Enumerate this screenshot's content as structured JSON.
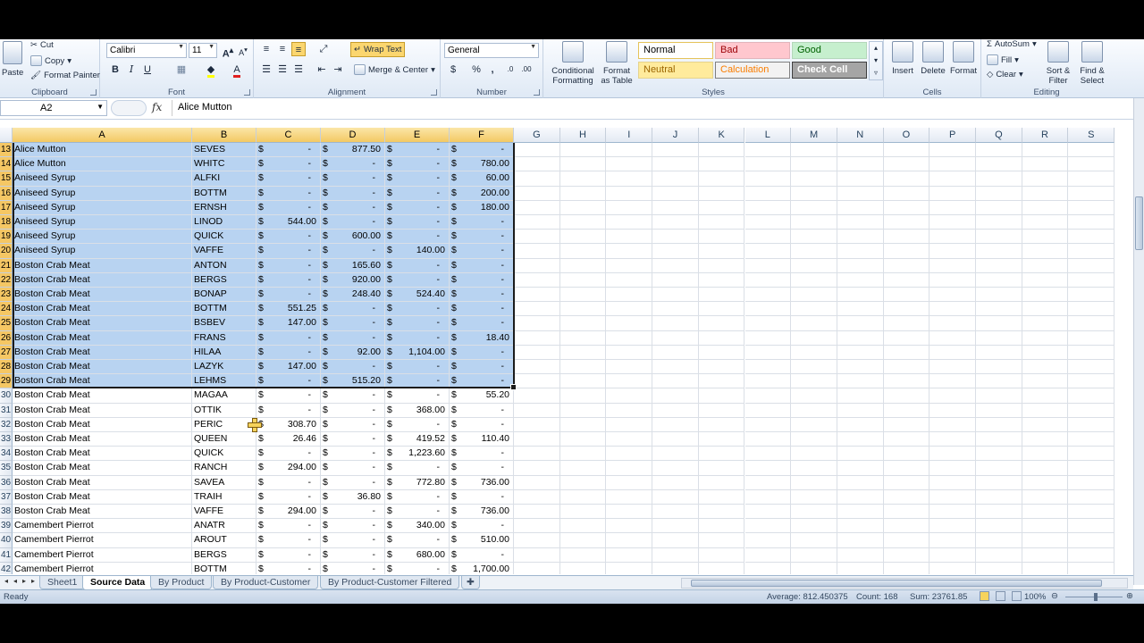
{
  "ribbon": {
    "clipboard": {
      "label": "Clipboard",
      "paste": "Paste",
      "cut": "Cut",
      "copy": "Copy",
      "format_painter": "Format Painter"
    },
    "font": {
      "label": "Font",
      "name": "Calibri",
      "size": "11",
      "bold": "B",
      "italic": "I",
      "underline": "U"
    },
    "alignment": {
      "label": "Alignment",
      "wrap_text": "Wrap Text",
      "merge_center": "Merge & Center"
    },
    "number": {
      "label": "Number",
      "format": "General",
      "currency": "$",
      "percent": "%",
      "comma": ","
    },
    "styles": {
      "label": "Styles",
      "conditional": "Conditional Formatting",
      "format_table": "Format as Table",
      "cells": [
        {
          "text": "Normal",
          "bg": "#ffffff",
          "fg": "#000000",
          "border": "#e5c35a"
        },
        {
          "text": "Bad",
          "bg": "#ffc7ce",
          "fg": "#9c0006",
          "border": "#e2b4ba"
        },
        {
          "text": "Good",
          "bg": "#c6efce",
          "fg": "#006100",
          "border": "#b3d7b9"
        },
        {
          "text": "Neutral",
          "bg": "#ffeb9c",
          "fg": "#9c6500",
          "border": "#e5d38c"
        },
        {
          "text": "Calculation",
          "bg": "#f2f2f2",
          "fg": "#fa7d00",
          "border": "#7f7f7f"
        },
        {
          "text": "Check Cell",
          "bg": "#a5a5a5",
          "fg": "#ffffff",
          "border": "#3f3f3f"
        }
      ]
    },
    "cells": {
      "label": "Cells",
      "insert": "Insert",
      "delete": "Delete",
      "format": "Format"
    },
    "editing": {
      "label": "Editing",
      "autosum": "AutoSum",
      "fill": "Fill",
      "clear": "Clear",
      "sort_filter": "Sort & Filter",
      "find_select": "Find & Select"
    }
  },
  "formula_bar": {
    "name_box": "A2",
    "fx": "fx",
    "content": "Alice Mutton"
  },
  "columns": [
    "A",
    "B",
    "C",
    "D",
    "E",
    "F",
    "G",
    "H",
    "I",
    "J",
    "K",
    "L",
    "M",
    "N",
    "O",
    "P",
    "Q",
    "R",
    "S"
  ],
  "selected_columns": [
    "A",
    "B",
    "C",
    "D",
    "E",
    "F"
  ],
  "rows": [
    {
      "n": "13",
      "a": "Alice Mutton",
      "b": "SEVES",
      "c": "-",
      "d": "877.50",
      "e": "-",
      "f": "-",
      "sel": true
    },
    {
      "n": "14",
      "a": "Alice Mutton",
      "b": "WHITC",
      "c": "-",
      "d": "-",
      "e": "-",
      "f": "780.00",
      "sel": true
    },
    {
      "n": "15",
      "a": "Aniseed Syrup",
      "b": "ALFKI",
      "c": "-",
      "d": "-",
      "e": "-",
      "f": "60.00",
      "sel": true
    },
    {
      "n": "16",
      "a": "Aniseed Syrup",
      "b": "BOTTM",
      "c": "-",
      "d": "-",
      "e": "-",
      "f": "200.00",
      "sel": true
    },
    {
      "n": "17",
      "a": "Aniseed Syrup",
      "b": "ERNSH",
      "c": "-",
      "d": "-",
      "e": "-",
      "f": "180.00",
      "sel": true
    },
    {
      "n": "18",
      "a": "Aniseed Syrup",
      "b": "LINOD",
      "c": "544.00",
      "d": "-",
      "e": "-",
      "f": "-",
      "sel": true
    },
    {
      "n": "19",
      "a": "Aniseed Syrup",
      "b": "QUICK",
      "c": "-",
      "d": "600.00",
      "e": "-",
      "f": "-",
      "sel": true
    },
    {
      "n": "20",
      "a": "Aniseed Syrup",
      "b": "VAFFE",
      "c": "-",
      "d": "-",
      "e": "140.00",
      "f": "-",
      "sel": true
    },
    {
      "n": "21",
      "a": "Boston Crab Meat",
      "b": "ANTON",
      "c": "-",
      "d": "165.60",
      "e": "-",
      "f": "-",
      "sel": true
    },
    {
      "n": "22",
      "a": "Boston Crab Meat",
      "b": "BERGS",
      "c": "-",
      "d": "920.00",
      "e": "-",
      "f": "-",
      "sel": true
    },
    {
      "n": "23",
      "a": "Boston Crab Meat",
      "b": "BONAP",
      "c": "-",
      "d": "248.40",
      "e": "524.40",
      "f": "-",
      "sel": true
    },
    {
      "n": "24",
      "a": "Boston Crab Meat",
      "b": "BOTTM",
      "c": "551.25",
      "d": "-",
      "e": "-",
      "f": "-",
      "sel": true
    },
    {
      "n": "25",
      "a": "Boston Crab Meat",
      "b": "BSBEV",
      "c": "147.00",
      "d": "-",
      "e": "-",
      "f": "-",
      "sel": true
    },
    {
      "n": "26",
      "a": "Boston Crab Meat",
      "b": "FRANS",
      "c": "-",
      "d": "-",
      "e": "-",
      "f": "18.40",
      "sel": true
    },
    {
      "n": "27",
      "a": "Boston Crab Meat",
      "b": "HILAA",
      "c": "-",
      "d": "92.00",
      "e": "1,104.00",
      "f": "-",
      "sel": true
    },
    {
      "n": "28",
      "a": "Boston Crab Meat",
      "b": "LAZYK",
      "c": "147.00",
      "d": "-",
      "e": "-",
      "f": "-",
      "sel": true
    },
    {
      "n": "29",
      "a": "Boston Crab Meat",
      "b": "LEHMS",
      "c": "-",
      "d": "515.20",
      "e": "-",
      "f": "-",
      "sel": true
    },
    {
      "n": "30",
      "a": "Boston Crab Meat",
      "b": "MAGAA",
      "c": "-",
      "d": "-",
      "e": "-",
      "f": "55.20",
      "sel": false
    },
    {
      "n": "31",
      "a": "Boston Crab Meat",
      "b": "OTTIK",
      "c": "-",
      "d": "-",
      "e": "368.00",
      "f": "-",
      "sel": false
    },
    {
      "n": "32",
      "a": "Boston Crab Meat",
      "b": "PERIC",
      "c": "308.70",
      "d": "-",
      "e": "-",
      "f": "-",
      "sel": false
    },
    {
      "n": "33",
      "a": "Boston Crab Meat",
      "b": "QUEEN",
      "c": "26.46",
      "d": "-",
      "e": "419.52",
      "f": "110.40",
      "sel": false
    },
    {
      "n": "34",
      "a": "Boston Crab Meat",
      "b": "QUICK",
      "c": "-",
      "d": "-",
      "e": "1,223.60",
      "f": "-",
      "sel": false
    },
    {
      "n": "35",
      "a": "Boston Crab Meat",
      "b": "RANCH",
      "c": "294.00",
      "d": "-",
      "e": "-",
      "f": "-",
      "sel": false
    },
    {
      "n": "36",
      "a": "Boston Crab Meat",
      "b": "SAVEA",
      "c": "-",
      "d": "-",
      "e": "772.80",
      "f": "736.00",
      "sel": false
    },
    {
      "n": "37",
      "a": "Boston Crab Meat",
      "b": "TRAIH",
      "c": "-",
      "d": "36.80",
      "e": "-",
      "f": "-",
      "sel": false
    },
    {
      "n": "38",
      "a": "Boston Crab Meat",
      "b": "VAFFE",
      "c": "294.00",
      "d": "-",
      "e": "-",
      "f": "736.00",
      "sel": false
    },
    {
      "n": "39",
      "a": "Camembert Pierrot",
      "b": "ANATR",
      "c": "-",
      "d": "-",
      "e": "340.00",
      "f": "-",
      "sel": false
    },
    {
      "n": "40",
      "a": "Camembert Pierrot",
      "b": "AROUT",
      "c": "-",
      "d": "-",
      "e": "-",
      "f": "510.00",
      "sel": false
    },
    {
      "n": "41",
      "a": "Camembert Pierrot",
      "b": "BERGS",
      "c": "-",
      "d": "-",
      "e": "680.00",
      "f": "-",
      "sel": false
    },
    {
      "n": "42",
      "a": "Camembert Pierrot",
      "b": "BOTTM",
      "c": "-",
      "d": "-",
      "e": "-",
      "f": "1,700.00",
      "sel": false
    }
  ],
  "currency_symbol": "$",
  "sheet_tabs": [
    {
      "label": "Sheet1",
      "active": false
    },
    {
      "label": "Source Data",
      "active": true
    },
    {
      "label": "By Product",
      "active": false
    },
    {
      "label": "By Product-Customer",
      "active": false
    },
    {
      "label": "By Product-Customer Filtered",
      "active": false
    }
  ],
  "status": {
    "ready": "Ready",
    "average": "Average: 812.450375",
    "count": "Count: 168",
    "sum": "Sum: 23761.85",
    "zoom": "100%"
  }
}
